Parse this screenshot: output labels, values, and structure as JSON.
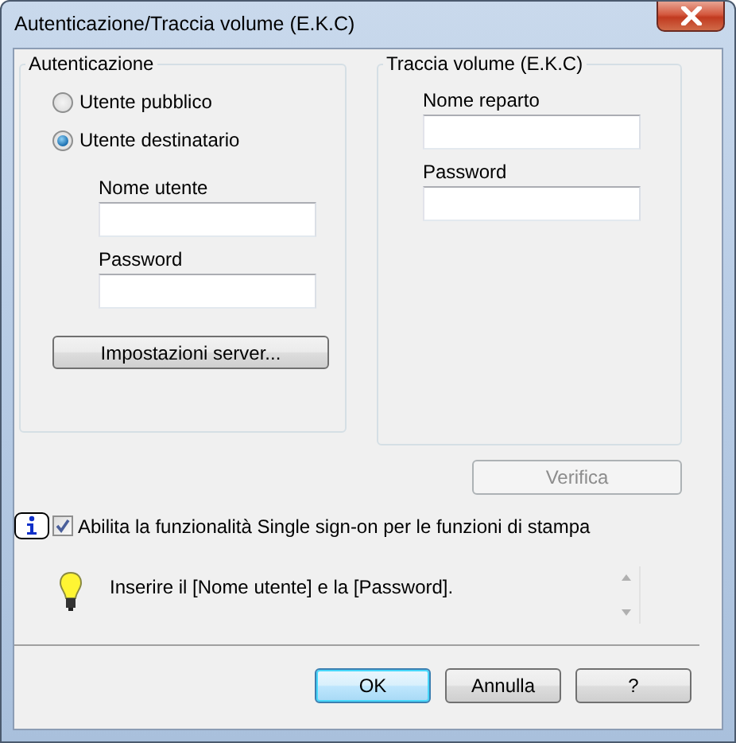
{
  "window": {
    "title": "Autenticazione/Traccia volume (E.K.C)"
  },
  "authentication": {
    "title": "Autenticazione",
    "options": [
      {
        "label": "Utente pubblico",
        "selected": false
      },
      {
        "label": "Utente destinatario",
        "selected": true
      }
    ],
    "fields": [
      {
        "label": "Nome utente"
      },
      {
        "label": "Password"
      }
    ],
    "server_button": "Impostazioni server..."
  },
  "account_track": {
    "title": "Traccia volume (E.K.C)",
    "fields": [
      {
        "label": "Nome reparto"
      },
      {
        "label": "Password"
      }
    ]
  },
  "verify_button": {
    "label": "Verifica",
    "disabled": true
  },
  "single_sign_on": {
    "label": "Abilita la funzionalità Single sign-on per le funzioni di stampa",
    "checked": true
  },
  "message": "Inserire il [Nome utente] e la [Password].",
  "buttons": [
    {
      "label": "OK",
      "default": true
    },
    {
      "label": "Annulla",
      "default": false
    },
    {
      "label": "?",
      "default": false
    }
  ]
}
